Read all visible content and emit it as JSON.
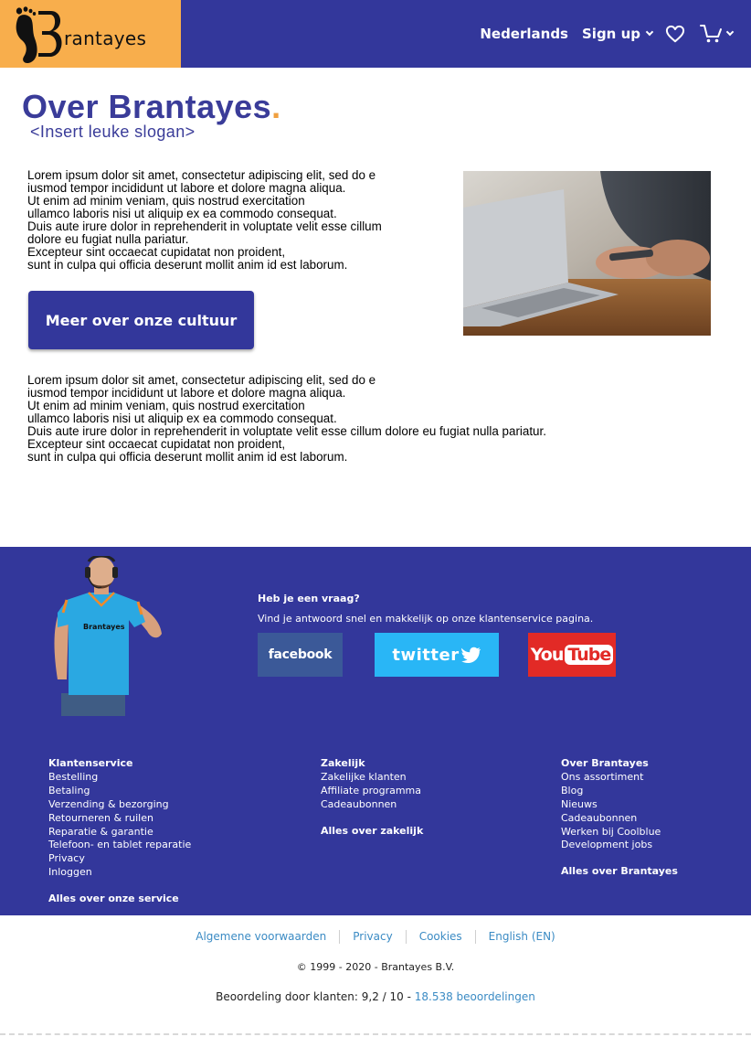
{
  "header": {
    "logo_text": "Brantayes",
    "logo_text_visible": "rantayes",
    "language": "Nederlands",
    "signup": "Sign up",
    "colors": {
      "bar": "#33379b",
      "logo_bg": "#f8ae4c"
    }
  },
  "main": {
    "title": "Over Brantayes",
    "title_dot": ".",
    "slogan": "<Insert leuke slogan>",
    "paragraph1": [
      "Lorem ipsum dolor sit amet, consectetur adipiscing elit, sed do e",
      "iusmod tempor incididunt ut labore et dolore magna aliqua.",
      "Ut enim ad minim veniam, quis nostrud exercitation",
      "ullamco laboris nisi ut aliquip ex ea commodo consequat.",
      "Duis aute irure dolor in reprehenderit in voluptate velit esse cillum",
      "dolore eu fugiat nulla pariatur.",
      "Excepteur sint occaecat cupidatat non proident,",
      "sunt in culpa qui officia deserunt mollit anim id est laborum."
    ],
    "cta_label": "Meer over onze cultuur",
    "paragraph2": [
      "Lorem ipsum dolor sit amet, consectetur adipiscing elit, sed do e",
      "iusmod tempor incididunt ut labore et dolore magna aliqua.",
      "Ut enim ad minim veniam, quis nostrud exercitation",
      "ullamco laboris nisi ut aliquip ex ea commodo consequat.",
      "Duis aute irure dolor in reprehenderit in voluptate velit esse cillum dolore eu fugiat nulla pariatur.",
      "Excepteur sint occaecat cupidatat non proident,",
      "sunt in culpa qui officia deserunt mollit anim id est laborum."
    ]
  },
  "footer": {
    "agent_shirt_text": "Brantayes",
    "question_title": "Heb je een vraag?",
    "question_text": "Vind je antwoord snel en makkelijk op onze klantenservice pagina.",
    "social": {
      "facebook": "facebook",
      "twitter": "twitter",
      "youtube_you": "You",
      "youtube_tube": "Tube"
    },
    "columns": [
      {
        "heading": "Klantenservice",
        "links": [
          "Bestelling",
          "Betaling",
          "Verzending & bezorging",
          "Retourneren & ruilen",
          "Reparatie & garantie",
          "Telefoon- en tablet reparatie",
          "Privacy",
          "Inloggen"
        ],
        "all_link": "Alles over onze service"
      },
      {
        "heading": "Zakelijk",
        "links": [
          "Zakelijke klanten",
          "Affiliate programma",
          "Cadeaubonnen"
        ],
        "all_link": "Alles over zakelijk"
      },
      {
        "heading": "Over Brantayes",
        "links": [
          "Ons assortiment",
          "Blog",
          "Nieuws",
          "Cadeaubonnen",
          "Werken bij Coolblue",
          "Development jobs"
        ],
        "all_link": "Alles over Brantayes"
      }
    ]
  },
  "bottom": {
    "legal_links": [
      "Algemene voorwaarden",
      "Privacy",
      "Cookies",
      "English (EN)"
    ],
    "copyright": "© 1999 - 2020 -  Brantayes B.V.",
    "rating_prefix": "Beoordeling door klanten: 9,2 / 10 - ",
    "rating_link": "18.538 beoordelingen"
  }
}
